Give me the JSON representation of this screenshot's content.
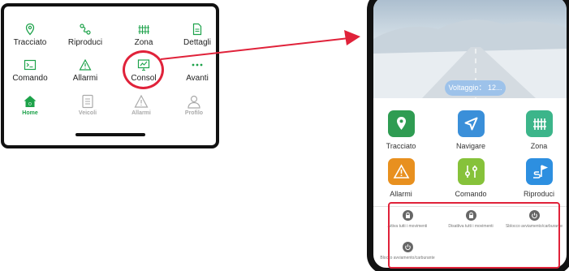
{
  "colors": {
    "accent_green": "#1da24a",
    "highlight_red": "#e0223a",
    "tile_green": "#2f9c52",
    "tile_blue": "#3a8fd9",
    "tile_teal": "#3cb58a",
    "tile_orange": "#e8901f",
    "tile_lime": "#86c23a",
    "tile_skyblue": "#2d8fe0",
    "voltage_pill": "#9dc2ea"
  },
  "left_phone": {
    "menu": [
      {
        "label": "Tracciato",
        "icon": "location-pin-icon"
      },
      {
        "label": "Riproduci",
        "icon": "route-icon"
      },
      {
        "label": "Zona",
        "icon": "fence-icon"
      },
      {
        "label": "Dettagli",
        "icon": "document-icon"
      },
      {
        "label": "Comando",
        "icon": "terminal-icon"
      },
      {
        "label": "Allarmi",
        "icon": "warning-icon"
      },
      {
        "label": "Consol",
        "icon": "monitor-chart-icon"
      },
      {
        "label": "Avanti",
        "icon": "more-dots-icon"
      }
    ],
    "tabs": [
      {
        "label": "Home",
        "icon": "home-icon"
      },
      {
        "label": "Veicoli",
        "icon": "list-icon"
      },
      {
        "label": "Allarmi",
        "icon": "alarm-triangle-icon"
      },
      {
        "label": "Profilo",
        "icon": "user-icon"
      }
    ]
  },
  "right_phone": {
    "voltage_label": "Voltaggio： 12...",
    "apps": [
      {
        "label": "Tracciato",
        "icon": "location-pin-icon"
      },
      {
        "label": "Navigare",
        "icon": "navigation-arrow-icon"
      },
      {
        "label": "Zona",
        "icon": "fence-icon"
      },
      {
        "label": "Allarmi",
        "icon": "warning-icon"
      },
      {
        "label": "Comando",
        "icon": "sliders-icon"
      },
      {
        "label": "Riproduci",
        "icon": "route-flag-icon"
      }
    ],
    "actions": [
      {
        "label": "Attiva tutti i movimenti",
        "icon": "lock-icon"
      },
      {
        "label": "Disattiva tutti i movimenti",
        "icon": "lock-icon"
      },
      {
        "label": "Sblocco avviamento/carburante",
        "icon": "power-icon"
      },
      {
        "label": "Blocco avviamento/carburante",
        "icon": "power-icon"
      }
    ]
  }
}
